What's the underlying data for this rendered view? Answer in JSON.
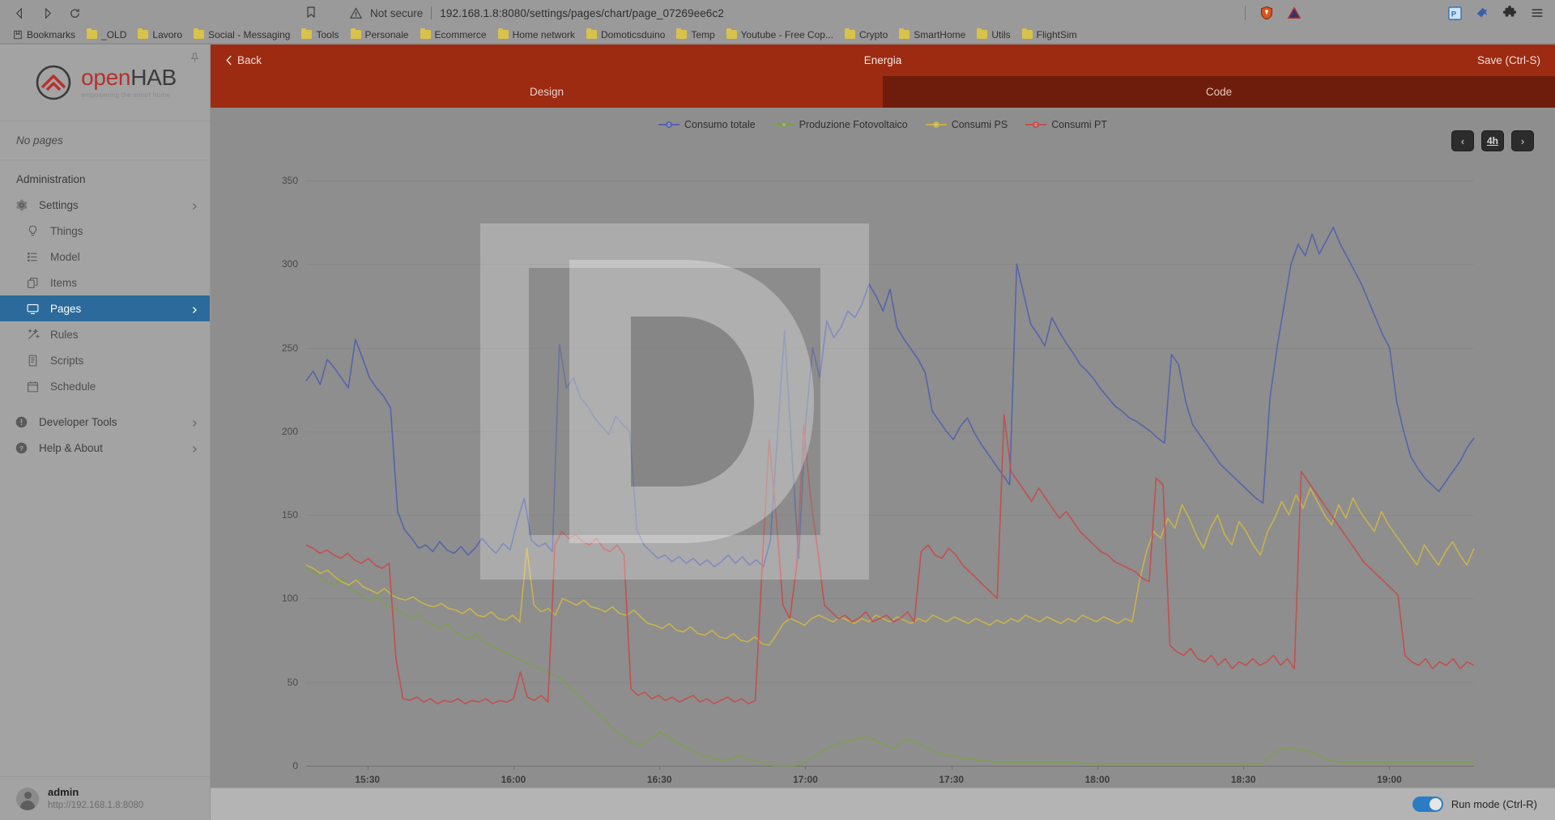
{
  "browser": {
    "back_label": "Back",
    "forward_label": "Forward",
    "reload_label": "Reload",
    "bookmark_label": "Bookmark this tab",
    "security_text": "Not secure",
    "url": "192.168.1.8:8080/settings/pages/chart/page_07269ee6c2",
    "right_icons": [
      "shield-icon",
      "warning-triangle-icon",
      "profile-icon",
      "extension-pin-icon",
      "extensions-puzzle-icon",
      "chrome-menu-icon"
    ]
  },
  "bookmarks": {
    "list_label": "Bookmarks",
    "items": [
      {
        "label": "_OLD"
      },
      {
        "label": "Lavoro"
      },
      {
        "label": "Social - Messaging"
      },
      {
        "label": "Tools"
      },
      {
        "label": "Personale"
      },
      {
        "label": "Ecommerce"
      },
      {
        "label": "Home network"
      },
      {
        "label": "Domoticsduino"
      },
      {
        "label": "Temp"
      },
      {
        "label": "Youtube - Free Cop..."
      },
      {
        "label": "Crypto"
      },
      {
        "label": "SmartHome"
      },
      {
        "label": "Utils"
      },
      {
        "label": "FlightSim"
      }
    ]
  },
  "sidebar": {
    "logo_open": "open",
    "logo_hab": "HAB",
    "logo_tagline": "empowering the smart home",
    "no_pages": "No pages",
    "section_title": "Administration",
    "items": [
      {
        "label": "Settings",
        "icon": "gear-icon",
        "level": 0,
        "chevron": true,
        "active": false
      },
      {
        "label": "Things",
        "icon": "lightbulb-icon",
        "level": 1,
        "chevron": false,
        "active": false
      },
      {
        "label": "Model",
        "icon": "list-icon",
        "level": 1,
        "chevron": false,
        "active": false
      },
      {
        "label": "Items",
        "icon": "copy-icon",
        "level": 1,
        "chevron": false,
        "active": false
      },
      {
        "label": "Pages",
        "icon": "monitor-icon",
        "level": 1,
        "chevron": true,
        "active": true
      },
      {
        "label": "Rules",
        "icon": "magic-wand-icon",
        "level": 1,
        "chevron": false,
        "active": false
      },
      {
        "label": "Scripts",
        "icon": "script-icon",
        "level": 1,
        "chevron": false,
        "active": false
      },
      {
        "label": "Schedule",
        "icon": "calendar-icon",
        "level": 1,
        "chevron": false,
        "active": false
      },
      {
        "label": "Developer Tools",
        "icon": "info-icon",
        "level": 0,
        "chevron": true,
        "active": false
      },
      {
        "label": "Help & About",
        "icon": "question-icon",
        "level": 0,
        "chevron": true,
        "active": false
      }
    ],
    "user": {
      "name": "admin",
      "url": "http://192.168.1.8:8080"
    }
  },
  "header": {
    "back_label": "Back",
    "title": "Energia",
    "save_label": "Save (Ctrl-S)",
    "tabs": [
      {
        "label": "Design",
        "active": false
      },
      {
        "label": "Code",
        "active": true
      }
    ]
  },
  "time_nav": {
    "prev_label": "‹",
    "range_label": "4h",
    "next_label": "›"
  },
  "status": {
    "run_mode_label": "Run mode (Ctrl-R)",
    "run_mode_on": true
  },
  "colors": {
    "accent_red": "#9c2b12",
    "tab_active": "#6e1d0c",
    "sidebar_active": "#2b6a9b",
    "toggle_on": "#2b7cc4",
    "series_blue": "#5664a8",
    "series_green": "#7d9e52",
    "series_yellow": "#c9b34a",
    "series_red": "#c2504f"
  },
  "chart_data": {
    "type": "line",
    "title": "Energia",
    "xlabel": "",
    "ylabel": "",
    "ylim": [
      0,
      360
    ],
    "yticks": [
      0,
      50,
      100,
      150,
      200,
      250,
      300,
      350
    ],
    "grid": true,
    "legend_position": "top-center",
    "xticks": [
      "15:30",
      "16:00",
      "16:30",
      "17:00",
      "17:30",
      "18:00",
      "18:30",
      "19:00"
    ],
    "x_range": [
      "15:15",
      "19:15"
    ],
    "series": [
      {
        "name": "Consumo totale",
        "color": "#5664a8",
        "values": [
          230,
          236,
          228,
          243,
          238,
          232,
          226,
          255,
          244,
          232,
          226,
          221,
          214,
          152,
          141,
          136,
          130,
          132,
          128,
          134,
          129,
          127,
          131,
          126,
          130,
          136,
          131,
          127,
          133,
          129,
          146,
          160,
          135,
          131,
          133,
          128,
          252,
          226,
          232,
          220,
          215,
          208,
          203,
          198,
          209,
          204,
          200,
          141,
          132,
          128,
          124,
          126,
          122,
          125,
          121,
          124,
          120,
          123,
          119,
          122,
          126,
          121,
          125,
          120,
          123,
          119,
          135,
          198,
          260,
          190,
          124,
          205,
          250,
          232,
          266,
          256,
          262,
          272,
          268,
          276,
          288,
          281,
          272,
          285,
          262,
          255,
          249,
          243,
          235,
          212,
          206,
          200,
          195,
          203,
          208,
          199,
          192,
          186,
          180,
          174,
          168,
          300,
          282,
          264,
          258,
          251,
          268,
          260,
          253,
          247,
          240,
          236,
          231,
          225,
          220,
          215,
          212,
          208,
          206,
          203,
          200,
          196,
          193,
          246,
          240,
          218,
          204,
          198,
          192,
          186,
          180,
          176,
          172,
          168,
          164,
          160,
          157,
          220,
          250,
          275,
          300,
          312,
          305,
          318,
          306,
          314,
          322,
          312,
          304,
          296,
          288,
          278,
          268,
          258,
          250,
          218,
          200,
          185,
          178,
          172,
          168,
          164,
          170,
          176,
          182,
          190,
          196
        ]
      },
      {
        "name": "Produzione Fotovoltaico",
        "color": "#7d9e52",
        "values": [
          118,
          116,
          113,
          110,
          108,
          112,
          106,
          104,
          101,
          99,
          102,
          97,
          95,
          93,
          90,
          88,
          91,
          86,
          84,
          82,
          85,
          80,
          78,
          76,
          79,
          74,
          72,
          70,
          68,
          66,
          64,
          62,
          60,
          58,
          56,
          54,
          52,
          48,
          44,
          40,
          36,
          32,
          28,
          24,
          20,
          17,
          14,
          12,
          14,
          17,
          20,
          18,
          15,
          12,
          10,
          8,
          6,
          5,
          4,
          3,
          4,
          6,
          5,
          3,
          2,
          1,
          0,
          0,
          0,
          0,
          1,
          3,
          6,
          9,
          11,
          13,
          14,
          15,
          16,
          17,
          16,
          14,
          12,
          10,
          14,
          16,
          14,
          12,
          10,
          8,
          7,
          6,
          5,
          4,
          4,
          3,
          3,
          2,
          2,
          2,
          2,
          2,
          2,
          2,
          2,
          2,
          2,
          2,
          2,
          2,
          1,
          1,
          1,
          1,
          1,
          1,
          1,
          1,
          1,
          1,
          1,
          1,
          1,
          1,
          1,
          1,
          1,
          1,
          1,
          1,
          1,
          1,
          1,
          1,
          1,
          1,
          5,
          8,
          10,
          10,
          10,
          9,
          8,
          6,
          4,
          3,
          2,
          2,
          2,
          2,
          2,
          2,
          2,
          2,
          2,
          2,
          2,
          2,
          2,
          2,
          2,
          2,
          2,
          2,
          2,
          2
        ]
      },
      {
        "name": "Consumi PS",
        "color": "#c9b34a",
        "values": [
          120,
          118,
          115,
          117,
          113,
          110,
          108,
          111,
          107,
          105,
          103,
          106,
          102,
          100,
          99,
          101,
          98,
          96,
          95,
          97,
          94,
          93,
          91,
          94,
          90,
          89,
          92,
          88,
          87,
          90,
          86,
          130,
          96,
          92,
          94,
          90,
          100,
          98,
          96,
          99,
          95,
          94,
          92,
          95,
          91,
          90,
          93,
          89,
          85,
          84,
          82,
          85,
          81,
          80,
          83,
          79,
          78,
          81,
          77,
          76,
          79,
          75,
          74,
          77,
          73,
          72,
          78,
          85,
          88,
          86,
          84,
          88,
          90,
          88,
          86,
          89,
          87,
          85,
          88,
          86,
          90,
          88,
          86,
          89,
          87,
          85,
          88,
          86,
          90,
          88,
          86,
          89,
          87,
          85,
          88,
          86,
          84,
          87,
          85,
          88,
          86,
          90,
          88,
          86,
          89,
          87,
          85,
          88,
          86,
          90,
          88,
          86,
          89,
          87,
          85,
          88,
          86,
          110,
          128,
          140,
          136,
          148,
          142,
          156,
          148,
          138,
          130,
          142,
          150,
          138,
          132,
          146,
          140,
          132,
          126,
          140,
          148,
          158,
          150,
          162,
          154,
          166,
          158,
          150,
          144,
          156,
          148,
          160,
          152,
          146,
          140,
          152,
          144,
          138,
          132,
          126,
          120,
          132,
          126,
          120,
          128,
          134,
          126,
          120,
          130
        ]
      },
      {
        "name": "Consumi PT",
        "color": "#c2504f",
        "values": [
          132,
          130,
          127,
          129,
          126,
          124,
          127,
          123,
          121,
          124,
          120,
          118,
          121,
          64,
          40,
          39,
          41,
          38,
          40,
          37,
          39,
          38,
          40,
          37,
          39,
          38,
          40,
          37,
          39,
          38,
          40,
          56,
          41,
          39,
          42,
          38,
          132,
          140,
          136,
          138,
          134,
          132,
          136,
          130,
          128,
          132,
          126,
          46,
          42,
          44,
          40,
          42,
          39,
          41,
          38,
          40,
          42,
          38,
          40,
          37,
          39,
          41,
          38,
          40,
          37,
          39,
          120,
          195,
          150,
          96,
          88,
          120,
          204,
          160,
          130,
          96,
          92,
          88,
          90,
          86,
          88,
          92,
          86,
          88,
          90,
          86,
          88,
          92,
          86,
          128,
          132,
          126,
          124,
          130,
          126,
          120,
          116,
          112,
          108,
          104,
          100,
          210,
          176,
          170,
          164,
          158,
          166,
          160,
          154,
          148,
          152,
          146,
          140,
          136,
          132,
          128,
          126,
          122,
          120,
          118,
          116,
          112,
          110,
          172,
          168,
          72,
          68,
          66,
          70,
          64,
          62,
          66,
          60,
          64,
          58,
          62,
          60,
          64,
          60,
          62,
          66,
          60,
          64,
          58,
          176,
          170,
          164,
          158,
          152,
          146,
          140,
          134,
          128,
          122,
          118,
          114,
          110,
          106,
          102,
          66,
          62,
          60,
          64,
          58,
          62,
          60,
          64,
          58,
          62,
          60
        ]
      }
    ]
  }
}
